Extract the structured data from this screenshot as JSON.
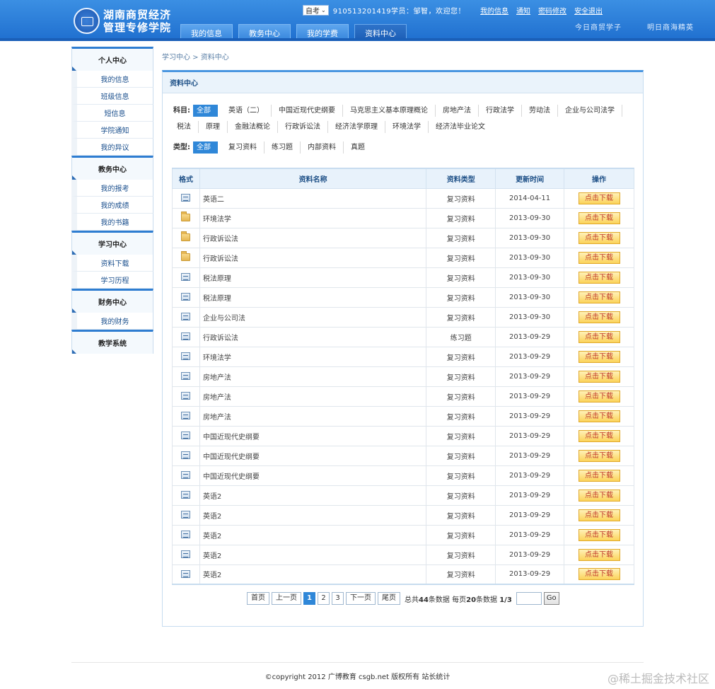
{
  "header": {
    "logo_line1": "湖南商贸经济",
    "logo_line2": "管理专修学院",
    "exam_select": "自考",
    "welcome": "910513201419学员：邹智，欢迎您！",
    "top_links": [
      "我的信息",
      "通知",
      "密码修改",
      "安全退出"
    ],
    "slogan_left": "今日商贸学子",
    "slogan_right": "明日商海精英",
    "tabs": [
      "我的信息",
      "教务中心",
      "我的学费",
      "资料中心"
    ],
    "active_tab": "资料中心"
  },
  "sidebar": [
    {
      "title": "个人中心",
      "items": [
        "我的信息",
        "班级信息",
        "短信息",
        "学院通知",
        "我的异议"
      ]
    },
    {
      "title": "教务中心",
      "items": [
        "我的报考",
        "我的成绩",
        "我的书籍"
      ]
    },
    {
      "title": "学习中心",
      "items": [
        "资料下载",
        "学习历程"
      ]
    },
    {
      "title": "财务中心",
      "items": [
        "我的财务"
      ]
    },
    {
      "title": "教学系统",
      "items": []
    }
  ],
  "breadcrumb": "学习中心 > 资料中心",
  "panel_title": "资料中心",
  "filters": {
    "subject_label": "科目:",
    "subjects": [
      "全部",
      "英语（二）",
      "中国近现代史纲要",
      "马克思主义基本原理概论",
      "房地产法",
      "行政法学",
      "劳动法",
      "企业与公司法学",
      "税法",
      "原理",
      "金融法概论",
      "行政诉讼法",
      "经济法学原理",
      "环境法学",
      "经济法毕业论文"
    ],
    "type_label": "类型:",
    "types": [
      "全部",
      "复习资料",
      "练习题",
      "内部资料",
      "真题"
    ]
  },
  "table": {
    "headers": [
      "格式",
      "资料名称",
      "资料类型",
      "更新时间",
      "操作"
    ],
    "download_label": "点击下载",
    "rows": [
      {
        "icon": "doc",
        "name": "英语二",
        "type": "复习资料",
        "date": "2014-04-11"
      },
      {
        "icon": "folder",
        "name": "环境法学",
        "type": "复习资料",
        "date": "2013-09-30"
      },
      {
        "icon": "folder",
        "name": "行政诉讼法",
        "type": "复习资料",
        "date": "2013-09-30"
      },
      {
        "icon": "folder",
        "name": "行政诉讼法",
        "type": "复习资料",
        "date": "2013-09-30"
      },
      {
        "icon": "doc",
        "name": "税法原理",
        "type": "复习资料",
        "date": "2013-09-30"
      },
      {
        "icon": "doc",
        "name": "税法原理",
        "type": "复习资料",
        "date": "2013-09-30"
      },
      {
        "icon": "doc",
        "name": "企业与公司法",
        "type": "复习资料",
        "date": "2013-09-30"
      },
      {
        "icon": "doc",
        "name": "行政诉讼法",
        "type": "练习题",
        "date": "2013-09-29"
      },
      {
        "icon": "doc",
        "name": "环境法学",
        "type": "复习资料",
        "date": "2013-09-29"
      },
      {
        "icon": "doc",
        "name": "房地产法",
        "type": "复习资料",
        "date": "2013-09-29"
      },
      {
        "icon": "doc",
        "name": "房地产法",
        "type": "复习资料",
        "date": "2013-09-29"
      },
      {
        "icon": "doc",
        "name": "房地产法",
        "type": "复习资料",
        "date": "2013-09-29"
      },
      {
        "icon": "doc",
        "name": "中国近现代史纲要",
        "type": "复习资料",
        "date": "2013-09-29"
      },
      {
        "icon": "doc",
        "name": "中国近现代史纲要",
        "type": "复习资料",
        "date": "2013-09-29"
      },
      {
        "icon": "doc",
        "name": "中国近现代史纲要",
        "type": "复习资料",
        "date": "2013-09-29"
      },
      {
        "icon": "doc",
        "name": "英语2",
        "type": "复习资料",
        "date": "2013-09-29"
      },
      {
        "icon": "doc",
        "name": "英语2",
        "type": "复习资料",
        "date": "2013-09-29"
      },
      {
        "icon": "doc",
        "name": "英语2",
        "type": "复习资料",
        "date": "2013-09-29"
      },
      {
        "icon": "doc",
        "name": "英语2",
        "type": "复习资料",
        "date": "2013-09-29"
      },
      {
        "icon": "doc",
        "name": "英语2",
        "type": "复习资料",
        "date": "2013-09-29"
      }
    ]
  },
  "pager": {
    "first": "首页",
    "prev": "上一页",
    "pages": [
      "1",
      "2",
      "3"
    ],
    "current": "1",
    "next": "下一页",
    "last": "尾页",
    "total_prefix": "总共",
    "total": "44",
    "total_suffix": "条数据 每页",
    "per_page": "20",
    "per_page_suffix": "条数据",
    "page_of": "1/3",
    "go_label": "Go"
  },
  "footer": "©copyright 2012 广博教育 csgb.net 版权所有 站长统计",
  "watermark": "@稀土掘金技术社区"
}
